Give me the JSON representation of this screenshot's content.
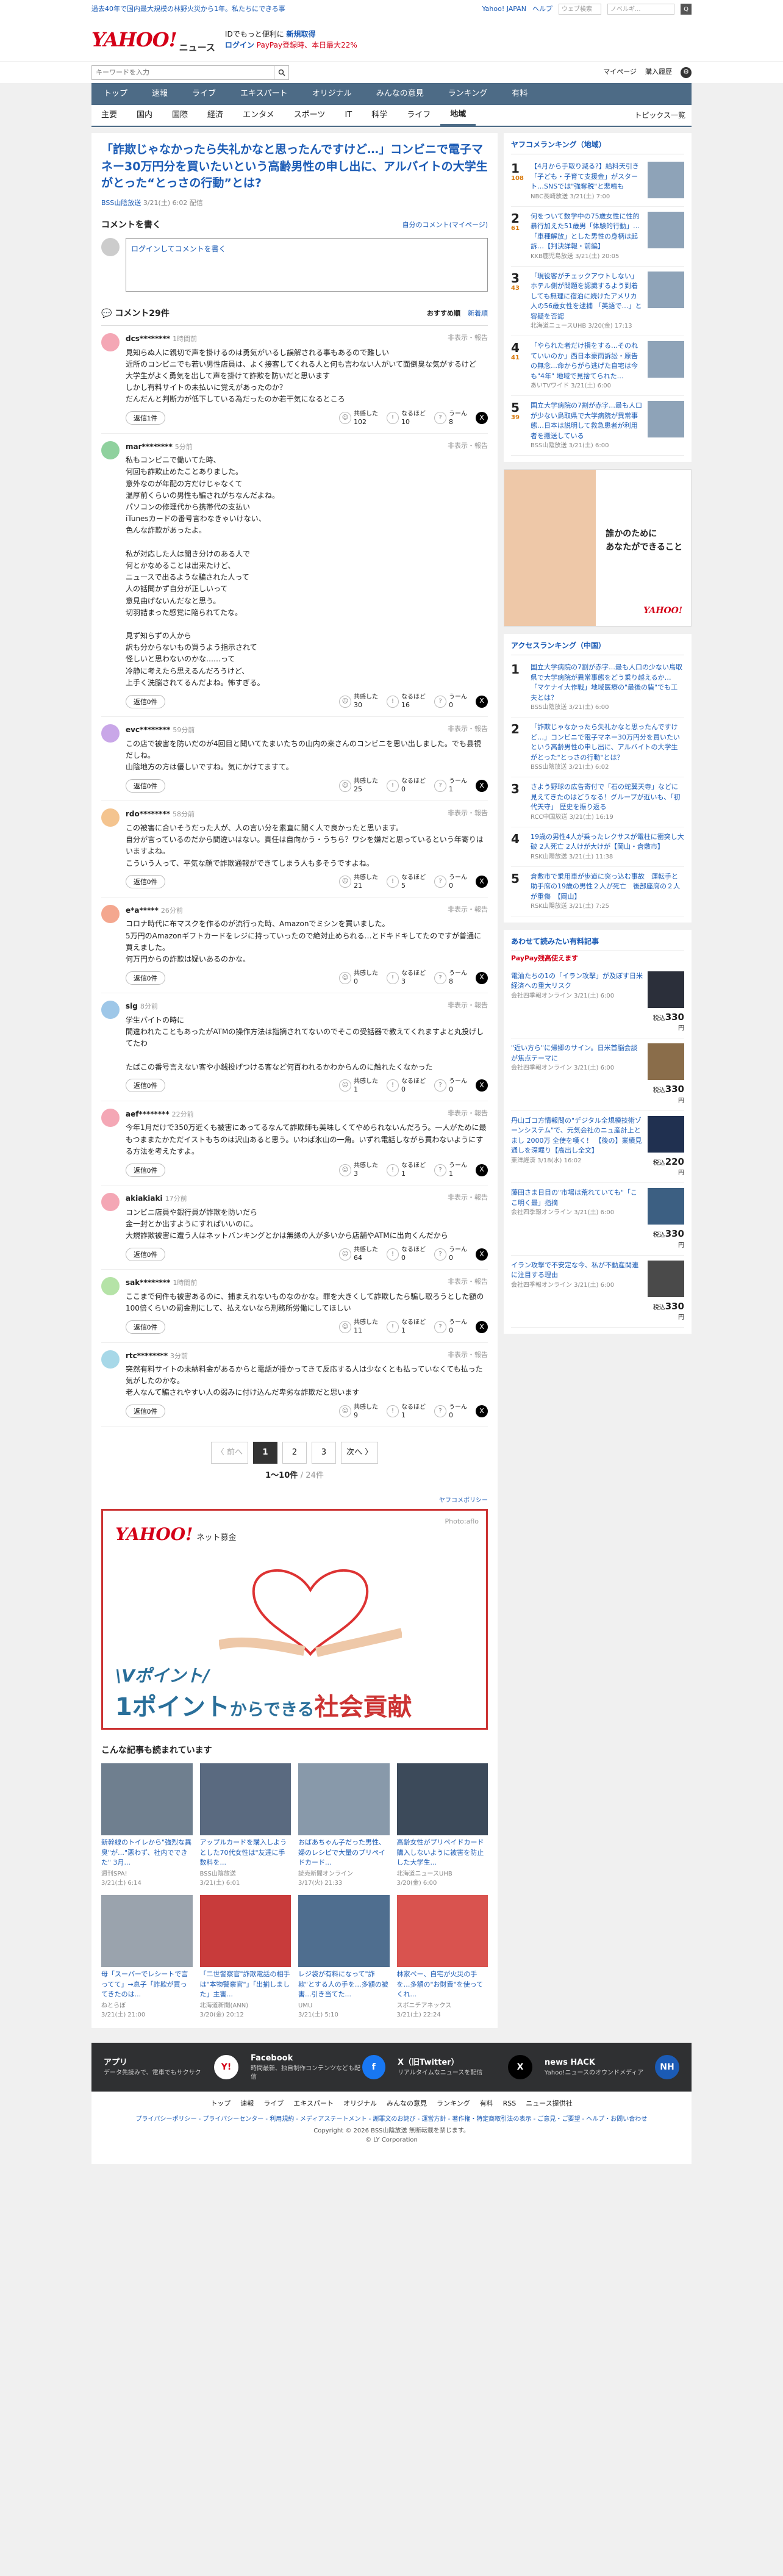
{
  "topbar": {
    "news_link": "過去40年で国内最大規模の林野火災から1年。私たちにできる事",
    "yahoo_japan": "Yahoo! JAPAN",
    "help": "ヘルプ",
    "search_placeholder": "ウェブ検索",
    "shop_placeholder": "ノベルギ...",
    "go_label": "Q"
  },
  "header": {
    "logo": "YAHOO!",
    "logo_sub": "JAPAN",
    "service": "ニュース",
    "promo_line1": "Yahoo!JAPAN",
    "promo_highlight": "新規取得",
    "promo_prefix": "IDでもっと便利に",
    "login": "ログイン",
    "promo_red": "PayPay登録時、本日最大22%"
  },
  "search": {
    "placeholder": "キーワードを入力",
    "mypage": "マイページ",
    "history": "購入履歴"
  },
  "mainnav": [
    {
      "label": "トップ",
      "active": false
    },
    {
      "label": "速報",
      "active": false
    },
    {
      "label": "ライブ",
      "active": false
    },
    {
      "label": "エキスパート",
      "active": false
    },
    {
      "label": "オリジナル",
      "active": false
    },
    {
      "label": "みんなの意見",
      "active": false
    },
    {
      "label": "ランキング",
      "active": false
    },
    {
      "label": "有料",
      "active": false
    }
  ],
  "subnav": [
    {
      "label": "主要",
      "active": false
    },
    {
      "label": "国内",
      "active": false
    },
    {
      "label": "国際",
      "active": false
    },
    {
      "label": "経済",
      "active": false
    },
    {
      "label": "エンタメ",
      "active": false
    },
    {
      "label": "スポーツ",
      "active": false
    },
    {
      "label": "IT",
      "active": false
    },
    {
      "label": "科学",
      "active": false
    },
    {
      "label": "ライフ",
      "active": false
    },
    {
      "label": "地域",
      "active": true
    }
  ],
  "topics_list": "トピックス一覧",
  "article": {
    "title": "「詐欺じゃなかったら失礼かなと思ったんですけど…」コンビニで電子マネー30万円分を買いたいという高齢男性の申し出に、アルバイトの大学生がとった“とっさの行動”とは?",
    "source": "BSS山陰放送",
    "date": "3/21(土) 6:02",
    "delivery": "配信"
  },
  "comments": {
    "write_heading": "コメントを書く",
    "mine_link": "自分のコメント(マイページ)",
    "login_prompt": "ログインしてコメントを書く",
    "count_label": "コメント29件",
    "sort_recommended": "おすすめ順",
    "sort_new": "新着順",
    "report": "非表示・報告",
    "label_agree": "共感した",
    "label_naruhodo": "なるほど",
    "label_unsure": "うーん",
    "items": [
      {
        "user": "dcs********",
        "age": "1時間前",
        "color": "#f4a7b5",
        "text": "見知らぬ人に親切で声を掛けるのは勇気がいるし誤解される事もあるので難しい\n近所のコンビニでも若い男性店員は、よく接客してくれる人と何も言わない人がいて面倒臭な気がするけど\n大学生がよく勇気を出して声を掛けて詐欺を防いだと思います\nしかし有料サイトの未払いに覚えがあったのか？\nだんだんと判断力が低下している為だったのか若干気になるところ",
        "reply": "返信1件",
        "agree": "102",
        "naruhodo": "10",
        "unsure": "8"
      },
      {
        "user": "mar********",
        "age": "5分前",
        "color": "#8fd19e",
        "text": "私もコンビニで働いてた時、\n何回も詐欺止めたことありました。\n意外なのが年配の方だけじゃなくて\n温厚前くらいの男性も騙されがちなんだよね。\nパソコンの修理代から携帯代の支払い\niTunesカードの番号言わなきゃいけない、\n色んな詐欺があったよ。\n\n私が対応した人は聞き分けのある人で\n何とかなめることは出来たけど、\nニュースで出るような騙された人って\n人の話聞かず自分が正しいって\n意見曲げないんだなと思う。\n切羽詰まった感覚に陥られてたな。\n\n見ず知らずの人から\n訳も分からないもの買うよう指示されて\n怪しいと思わないのかな……って\n冷静に考えたら思えるんだろうけど、\n上手く洗脳されてるんだよね。怖すぎる。",
        "reply": "返信0件",
        "agree": "30",
        "naruhodo": "16",
        "unsure": "0"
      },
      {
        "user": "evc********",
        "age": "59分前",
        "color": "#c9a7e8",
        "text": "この店で被害を防いだのが4回目と聞いてたまいたちの山内の来さんのコンビニを思い出しました。でも县視だしね。\n山陰地方の方は優しいですね。気にかけてますて。",
        "reply": "返信0件",
        "agree": "25",
        "naruhodo": "0",
        "unsure": "1"
      },
      {
        "user": "rdo********",
        "age": "58分前",
        "color": "#f4c48f",
        "text": "この被害に合いそうだった人が、人の言い分を素直に聞く人で良かったと思います。\n自分が言っているのだから間違いはない。責任は自向かう・うちら？ワシを嫌だと思っているという年寄りはいますよね。\nこういう人って、平気な顔で詐欺通報ができてしまう人も多そうですよね。",
        "reply": "返信0件",
        "agree": "21",
        "naruhodo": "5",
        "unsure": "0"
      },
      {
        "user": "e*a*****",
        "age": "26分前",
        "color": "#f4a78f",
        "text": "コロナ時代に布マスクを作るのが流行った時、Amazonでミシンを買いました。\n5万円のAmazonギフトカードをレジに持っていったので絶対止められる…とドキドキしてたのですが普通に買えました。\n何万円からの詐欺は疑いあるのかな。",
        "reply": "返信0件",
        "agree": "0",
        "naruhodo": "3",
        "unsure": "8"
      },
      {
        "user": "sig",
        "age": "8分前",
        "color": "#9ec7e8",
        "text": "学生バイトの時に\n間違われたこともあったがATMの操作方法は指摘されてないのでそこの受話器で教えてくれますよと丸投げしてたわ\n\nたぱこの番号言えない客や小銭投げつける客など何百われるかわからんのに触れたくなかった",
        "reply": "返信0件",
        "agree": "1",
        "naruhodo": "0",
        "unsure": "0"
      },
      {
        "user": "aef********",
        "age": "22分前",
        "color": "#f4a7b5",
        "text": "今年1月だけで350万近くも被害にあってるなんて詐欺師も美味しくてやめられないんだろう。一人がために最もつままたかただイストもちのは沢山あると思う。いわば氷山の一角。いずれ電話しながら買わないようにする方法を考えたすよ。",
        "reply": "返信0件",
        "agree": "3",
        "naruhodo": "1",
        "unsure": "1"
      },
      {
        "user": "akiakiaki",
        "age": "17分前",
        "color": "#f4a7b5",
        "text": "コンビニ店員や銀行員が詐欺を防いだら\n金一封とか出すようにすればいいのに。\n大規詐欺被害に遭う人はネットバンキングとかは無縁の人が多いから店舗やATMに出向くんだから",
        "reply": "返信0件",
        "agree": "64",
        "naruhodo": "0",
        "unsure": "0"
      },
      {
        "user": "sak********",
        "age": "1時間前",
        "color": "#b5e3a7",
        "text": "ここまで何件も被害あるのに、捕まえれないものなのかな。罪を大きくして詐欺したら騙し取ろうとした額の100倍くらいの罰金刑にして、払えないなら刑務所労働にしてほしい",
        "reply": "返信0件",
        "agree": "11",
        "naruhodo": "1",
        "unsure": "0"
      },
      {
        "user": "rtc********",
        "age": "3分前",
        "color": "#a7d8e8",
        "text": "突然有料サイトの未納料金があるからと電話が掛かってきて反応する人は少なくとも払っていなくても払った気がしたのかな。\n老人なんて騙されやすい人の弱みに付け込んだ卑劣な詐欺だと思います",
        "reply": "返信0件",
        "agree": "9",
        "naruhodo": "1",
        "unsure": "0"
      }
    ]
  },
  "pager": {
    "prev": "〈 前へ",
    "pages": [
      "1",
      "2",
      "3"
    ],
    "next": "次へ 〉",
    "range": "1〜10件",
    "total": "/ 24件"
  },
  "ad": {
    "label": "ヤフコメポリシー",
    "logo": "YAHOO!",
    "logo_sub": "ネット募金",
    "photo_credit": "Photo:aflo",
    "sub": "\\Vポイント/",
    "main_blue": "1ポイント",
    "main_mid": "からできる",
    "main_red": "社会貢献"
  },
  "related": {
    "heading": "こんな記事も読まれています",
    "items": [
      {
        "title": "新幹線のトイレから\"強烈な異臭\"が…\"悪わず、社内でできた\" 3月...",
        "src": "週刊SPA!",
        "date": "3/21(土) 6:14",
        "color": "#6f7f8f"
      },
      {
        "title": "アップルカードを購入しようとした70代女性は\"友達に手数料を...",
        "src": "BSS山陰放送",
        "date": "3/21(土) 6:01",
        "color": "#5a6a80"
      },
      {
        "title": "おばあちゃん子だった男性、婦のレシピで大量のプリペイドカード...",
        "src": "読売新聞オンライン",
        "date": "3/17(火) 21:33",
        "color": "#8899aa"
      },
      {
        "title": "高齢女性がプリペイドカード購入しないように被害を防止した大学生...",
        "src": "北海道ニュースUHB",
        "date": "3/20(金) 6:00",
        "color": "#3c4a5a"
      },
      {
        "title": "母「スーパーでレシートで言ってて」→息子「詐欺が買ってきたのは...",
        "src": "ねとらぼ",
        "date": "3/21(土) 21:00",
        "color": "#9aa3ad"
      },
      {
        "title": "「二世警察官\"詐欺電話の相手は\"本物警察官\"」「出揃しました」主害...",
        "src": "北海道新聞(ANN)",
        "date": "3/20(金) 20:12",
        "color": "#c83b3b"
      },
      {
        "title": "レジ袋が有料になって\"詐欺\"とする人の手を…多額の被害...引き当てた...",
        "src": "UMU",
        "date": "3/21(土) 5:10",
        "color": "#4f6e8f"
      },
      {
        "title": "林家ペー、自宅が火災の手を…多額の\"お財費\"を使ってくれ...",
        "src": "スポニチアネックス",
        "date": "3/21(土) 22:24",
        "color": "#d9534f"
      }
    ]
  },
  "sidebar": {
    "local_heading": "ヤフコメランキング（地域）",
    "local": [
      {
        "n": "1",
        "sub": "108",
        "text": "【4月から手取り減る?】給料天引き「子ども・子育て支援金」がスタート…SNSでは\"強奪税\"と悲鳴も",
        "src": "NBC長崎放送 3/21(土) 7:00"
      },
      {
        "n": "2",
        "sub": "61",
        "text": "何をついて数学中の75歳女性に性的暴行加えた51歳男「体験的行動」…「車種解放」とした男性の身柄は起訴…【判決詳報・前編】",
        "src": "KKB鹿児島放送 3/21(土) 20:05"
      },
      {
        "n": "3",
        "sub": "43",
        "text": "「現役客がチェックアウトしない」ホテル側が問題を認識するよう到着しても無理に宿泊に続けたアメリカ人の56歳女性を逮捕 「英語で…」と容疑を否認",
        "src": "北海道ニュースUHB 3/20(金) 17:13"
      },
      {
        "n": "4",
        "sub": "41",
        "text": "「やられた者だけ損をする…そのれていいのか」西日本豪雨訴訟・原告の無念…命からがら逃げた自宅は今も\"4年\" 地域で見捨てられた…",
        "src": "あいTVワイド 3/21(土) 6:00"
      },
      {
        "n": "5",
        "sub": "39",
        "text": "国立大学病院の7割が赤字…最も人口が少ない鳥取県で大学病院が異常事態…日本は説明して救急患者が利用者を搬送している",
        "src": "BSS山陰放送 3/21(土) 6:00"
      }
    ],
    "side_ad_copy1": "誰かのために",
    "side_ad_copy2": "あなたができること",
    "side_ad_logo": "YAHOO!",
    "access_heading": "アクセスランキング（中国）",
    "access": [
      {
        "n": "1",
        "text": "国立大学病院の7割が赤字…最も人口の少ない鳥取県で大学病院が異常事態をどう乗り越えるか…「マケナイ大作戦」地域医療の\"最後の砦\"でも工夫とは？",
        "src": "BSS山陰放送 3/21(土) 6:00"
      },
      {
        "n": "2",
        "text": "「詐欺じゃなかったら失礼かなと思ったんですけど…」コンビニで電子マネー30万円分を買いたいという高齢男性の申し出に、アルバイトの大学生がとった\"とっさの行動\"とは？",
        "src": "BSS山陰放送 3/21(土) 6:02"
      },
      {
        "n": "3",
        "text": "さよう野球の広告寄付で「石の蛇翼天寺」などに見えてきたのはどうなる！グループが近いも、「初代天守」 歴史を振り返る",
        "src": "RCC中国放送 3/21(土) 16:19"
      },
      {
        "n": "4",
        "text": "19歳の男性4人が乗ったレクサスが電柱に衝突し大破 2人死亡 2人けが大けが【岡山・倉敷市】",
        "src": "RSK山陽放送 3/21(土) 11:38"
      },
      {
        "n": "5",
        "text": "倉敷市で乗用車が歩道に突っ込む事故　運転手と助手席の19歳の男性２人が死亡　後部座席の２人が重傷　【岡山】",
        "src": "RSK山陽放送 3/21(土) 7:25"
      }
    ],
    "paid_heading": "あわせて読みたい有料記事",
    "paypay_note": "PayPay残高使えます",
    "paid": [
      {
        "text": "電油たちの1の「イラン攻撃」が及ぼす日米経済への重大リスク",
        "src": "会社四季報オンライン 3/21(土) 6:00",
        "price": "330",
        "color": "#2b2f3a"
      },
      {
        "text": "\"近い方ら\"に帰郷のサイン。日米首脳会談が焦点テーマに",
        "src": "会社四季報オンライン 3/21(土) 6:00",
        "price": "330",
        "color": "#8a6d4a"
      },
      {
        "text": "丹山ゴコ方情報問の\"デジタル全規模技術ゾーンシステム\"で、元気会社のニュ産計上とまし 2000万 全使を嘆く！ 【後の】業績見通しを深堀り【高出し全文】",
        "src": "東洋経済 3/18(水) 16:02",
        "price": "220",
        "color": "#203050"
      },
      {
        "text": "藤田さま日目の\"市場は荒れていても\"「ここ明く最」指摘",
        "src": "会社四季報オンライン 3/21(土) 6:00",
        "price": "330",
        "color": "#3c5f82"
      },
      {
        "text": "イラン攻撃で不安定な今、私が不動産関連に注目する理由",
        "src": "会社四季報オンライン 3/21(土) 6:00",
        "price": "330",
        "color": "#4a4a4a"
      }
    ],
    "price_prefix": "税込",
    "price_suffix": "円"
  },
  "footer": {
    "apps": [
      {
        "title": "アプリ",
        "desc": "データ先読みで、電車でもサクサク",
        "icon": "Y!",
        "color": "#fff"
      },
      {
        "title": "Facebook",
        "desc": "時間最新、独自制作コンテンツなども配信",
        "icon": "f",
        "color": "#1877f2"
      },
      {
        "title": "X（旧Twitter）",
        "desc": "リアルタイムなニュースを配信",
        "icon": "X",
        "color": "#000"
      },
      {
        "title": "news HACK",
        "desc": "Yahoo!ニュースのオウンドメディア",
        "icon": "NH",
        "color": "#1b5bb5"
      }
    ],
    "links": [
      "トップ",
      "速報",
      "ライブ",
      "エキスパート",
      "オリジナル",
      "みんなの意見",
      "ランキング",
      "有料",
      "RSS",
      "ニュース提供社"
    ],
    "small_links": "プライバシーポリシー - プライバシーセンター - 利用規約 - メディアステートメント - 謝罪文のお詫び - 運営方針 - 著作権・特定商取引法の表示 - ご意見・ご要望 - ヘルプ・お問い合わせ",
    "copy1": "Copyright © 2026 BSS山陰放送 無断転載を禁じます。",
    "copy2": "© LY Corporation"
  }
}
